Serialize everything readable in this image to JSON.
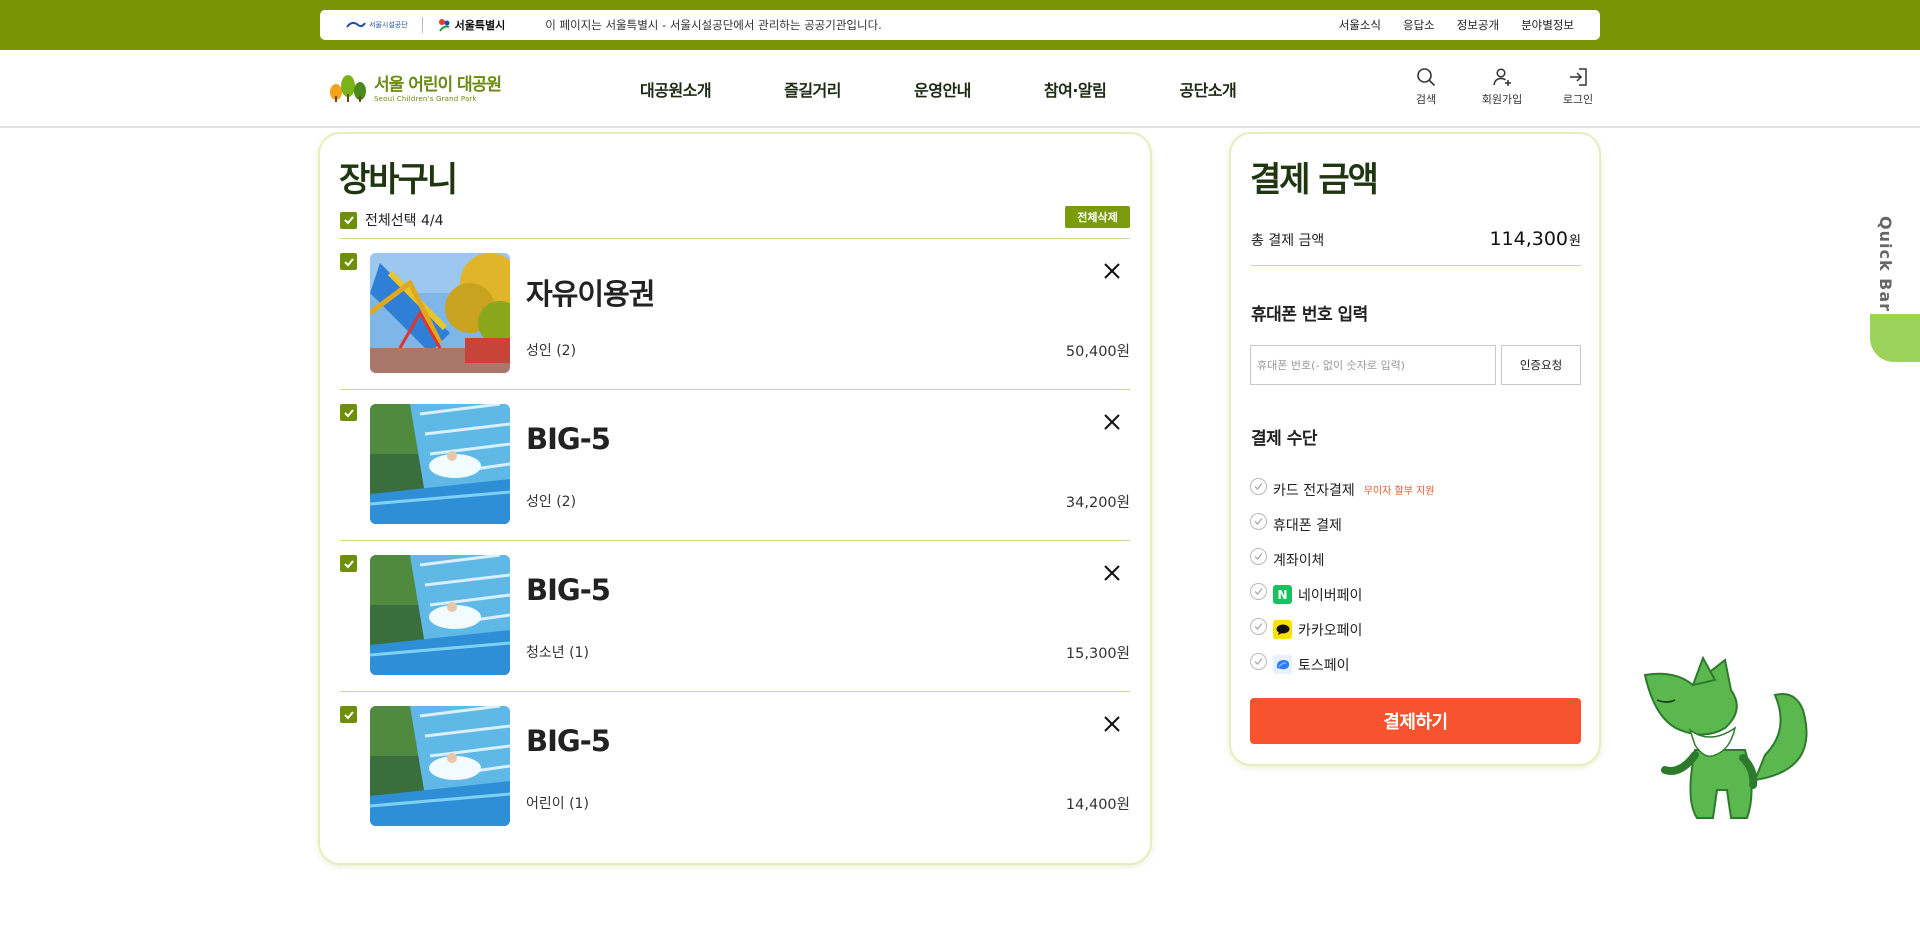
{
  "gov_bar": {
    "logo_sisul": "서울시설공단",
    "logo_seoul": "서울특별시",
    "notice": "이 페이지는 서울특별시 - 서울시설공단에서 관리하는 공공기관입니다.",
    "links": [
      "서울소식",
      "응답소",
      "정보공개",
      "분야별정보"
    ]
  },
  "header": {
    "brand_ko": "서울 어린이 대공원",
    "brand_en": "Seoul Children's Grand Park",
    "nav": [
      "대공원소개",
      "즐길거리",
      "운영안내",
      "참여·알림",
      "공단소개"
    ],
    "utils": [
      {
        "icon": "search-icon",
        "label": "검색"
      },
      {
        "icon": "user-plus-icon",
        "label": "회원가입"
      },
      {
        "icon": "login-icon",
        "label": "로그인"
      }
    ]
  },
  "cart": {
    "title": "장바구니",
    "select_all": "전체선택 4/4",
    "delete_all": "전체삭제",
    "items": [
      {
        "name": "자유이용권",
        "option": "성인 (2)",
        "price": "50,400원",
        "thumb": "ride-photo",
        "checked": true
      },
      {
        "name": "BIG-5",
        "option": "성인 (2)",
        "price": "34,200원",
        "thumb": "water-slide-photo",
        "checked": true
      },
      {
        "name": "BIG-5",
        "option": "청소년 (1)",
        "price": "15,300원",
        "thumb": "water-slide-photo",
        "checked": true
      },
      {
        "name": "BIG-5",
        "option": "어린이 (1)",
        "price": "14,400원",
        "thumb": "water-slide-photo",
        "checked": true
      }
    ]
  },
  "payment": {
    "title": "결제 금액",
    "total_label": "총 결제 금액",
    "total_amount": "114,300",
    "total_unit": "원",
    "phone_title": "휴대폰 번호 입력",
    "phone_placeholder": "휴대폰 번호(- 없이 숫자로 입력)",
    "verify_button": "인증요청",
    "method_title": "결제 수단",
    "methods": [
      {
        "label": "카드 전자결제",
        "badge": "무이자 할부 지원",
        "icon": ""
      },
      {
        "label": "휴대폰 결제",
        "badge": "",
        "icon": ""
      },
      {
        "label": "계좌이체",
        "badge": "",
        "icon": ""
      },
      {
        "label": "네이버페이",
        "badge": "",
        "icon": "naver-pay-icon",
        "icon_glyph": "N"
      },
      {
        "label": "카카오페이",
        "badge": "",
        "icon": "kakao-pay-icon"
      },
      {
        "label": "토스페이",
        "badge": "",
        "icon": "toss-pay-icon"
      }
    ],
    "pay_button": "결제하기"
  },
  "quick_bar": {
    "label": "Quick Bar"
  },
  "colors": {
    "gov_bar": "#7a9307",
    "accent_green": "#6f8e0a",
    "title_green": "#1f3611",
    "pay_button": "#f7532e",
    "badge_red": "#e9552b",
    "quick_tab": "#9bd35b"
  }
}
